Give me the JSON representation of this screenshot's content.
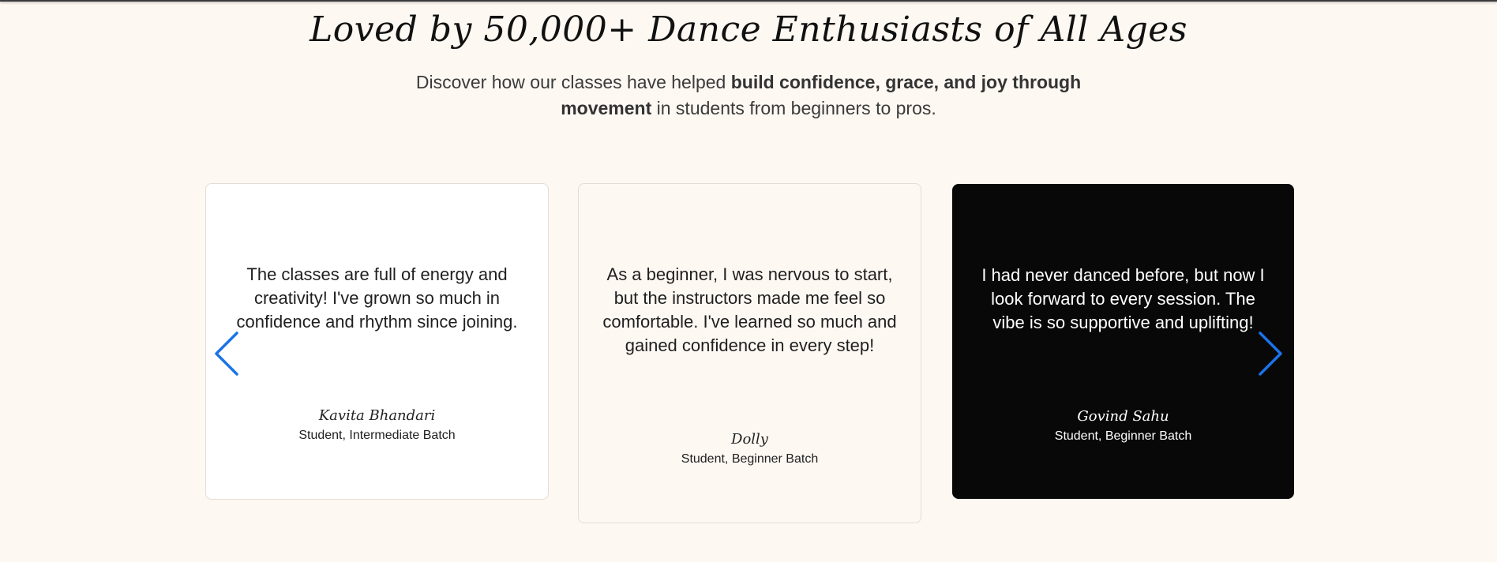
{
  "section": {
    "heading": "Loved by 50,000+ Dance Enthusiasts of All Ages",
    "subtitle_pre": "Discover how our classes have helped ",
    "subtitle_bold": "build confidence, grace, and joy through movement",
    "subtitle_post": " in students from beginners to pros."
  },
  "testimonials": [
    {
      "quote": "The classes are full of energy and creativity! I've grown so much in confidence and rhythm since joining.",
      "name": "Kavita Bhandari",
      "role": "Student, Intermediate Batch"
    },
    {
      "quote": "As a beginner, I was nervous to start, but the instructors made me feel so comfortable. I've learned so much and gained confidence in every step!",
      "name": "Dolly",
      "role": "Student, Beginner Batch"
    },
    {
      "quote": "I had never danced before, but now I look forward to every session. The vibe is so supportive and uplifting!",
      "name": "Govind Sahu",
      "role": "Student, Beginner Batch"
    }
  ],
  "carousel": {
    "prev_icon": "chevron-left-icon",
    "next_icon": "chevron-right-icon",
    "arrow_color": "#1a73e8"
  },
  "colors": {
    "page_background": "#fdf8f2",
    "highlight_card": "#080808"
  }
}
